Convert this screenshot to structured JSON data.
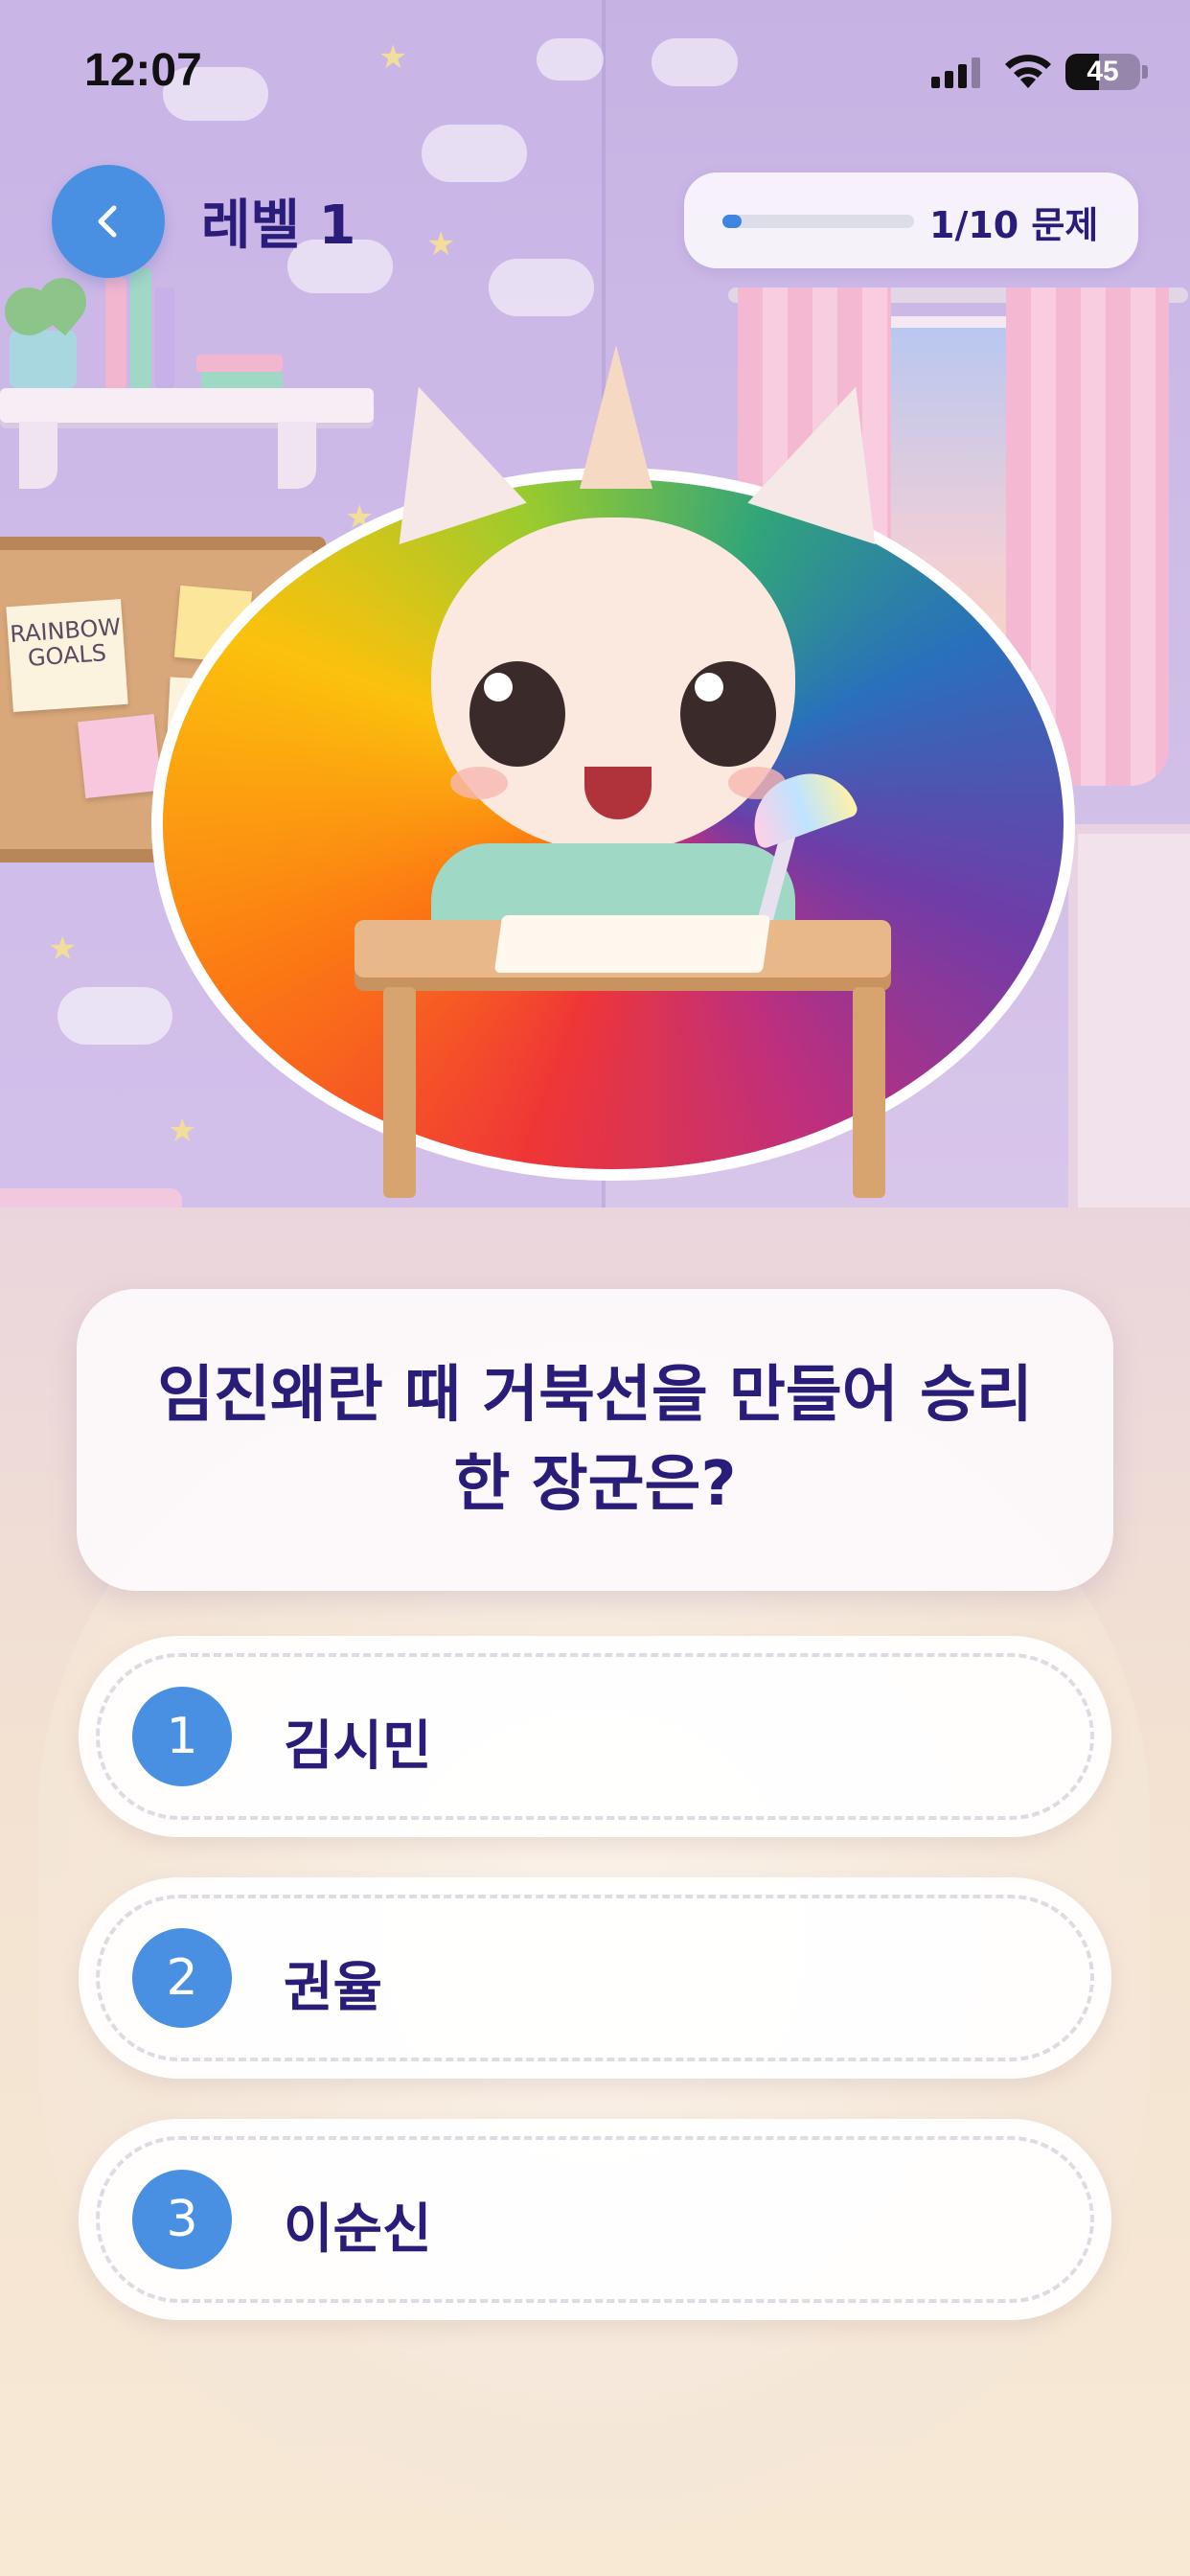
{
  "status_bar": {
    "time": "12:07",
    "battery": "45",
    "battery_level": 0.45
  },
  "header": {
    "back_icon": "chevron-left-icon",
    "level_title": "레벨 1",
    "progress": {
      "text": "1/10 문제",
      "current": 1,
      "total": 10
    }
  },
  "background_notes": {
    "goals": "RAINBOW GOALS"
  },
  "question": {
    "text": "임진왜란 때 거북선을 만들어 승리한 장군은?"
  },
  "options": [
    {
      "number": "1",
      "label": "김시민"
    },
    {
      "number": "2",
      "label": "권율"
    },
    {
      "number": "3",
      "label": "이순신"
    }
  ],
  "colors": {
    "accent_blue": "#4a90e2",
    "text_navy": "#2a1d7a",
    "progress_fill": "#3f86e0"
  }
}
